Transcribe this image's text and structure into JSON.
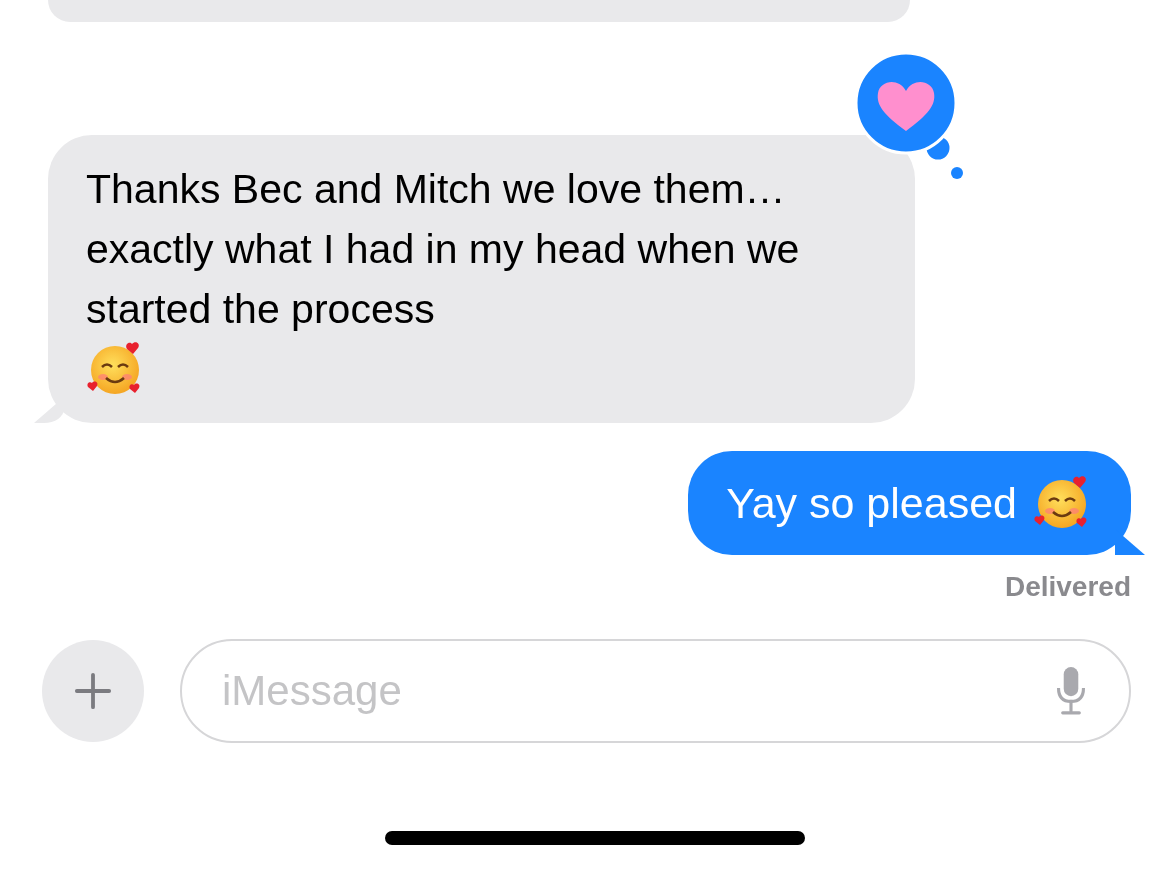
{
  "messages": [
    {
      "kind": "received",
      "text": "Thanks Bec and Mitch we love them…exactly what I had in my head when we started the process",
      "emoji": true,
      "heart_reaction": true
    },
    {
      "kind": "sent",
      "text": "Yay so pleased",
      "emoji": true,
      "heart_reaction": false
    }
  ],
  "status": "Delivered",
  "composer": {
    "placeholder": "iMessage"
  }
}
